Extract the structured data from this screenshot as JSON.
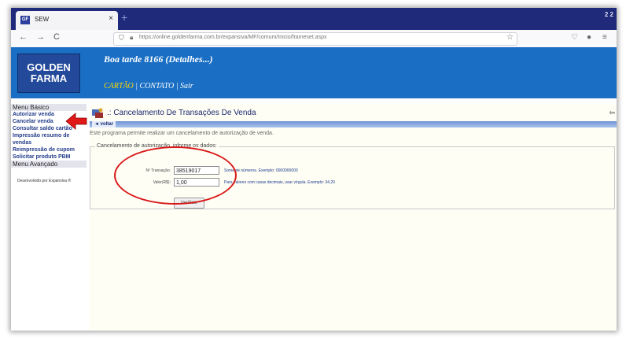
{
  "browser": {
    "tab_title": "SEW",
    "tab_icon_text": "GF",
    "tab_close": "×",
    "new_tab": "+",
    "corner_text": "2 2",
    "back": "←",
    "forward": "→",
    "reload": "C",
    "url": "https://online.goldenfarma.com.br/expansiva/MF/comum/Inicio/frameset.aspx",
    "star": "☆"
  },
  "header": {
    "logo_line1": "GOLDEN",
    "logo_line2": "FARMA",
    "greeting": "Boa tarde 8166 (Detalhes...)",
    "link_cartao": "CARTÃO",
    "link_contato": "CONTATO",
    "link_sair": "Sair",
    "separator": "|"
  },
  "sidebar": {
    "menu_basico": "Menu Básico",
    "items": [
      "Autorizar venda",
      "Cancelar venda",
      "Consultar saldo cartão",
      "Impressão resumo de vendas",
      "Reimpressão de cupom",
      "Solicitar produto PBM"
    ],
    "menu_avancado": "Menu Avançado",
    "footer": "Desenvolvido por Expansiva ®"
  },
  "main": {
    "title": ".: Cancelamento De Transações De Venda",
    "voltar": "◄ voltar",
    "description": "Este programa permite realizar um cancelamento de autorização de venda.",
    "legend": "Cancelamento de autorização, informe os dados:",
    "transacao_label": "Nº Transação:",
    "transacao_value": "38519017",
    "transacao_hint": "Somente números. Exemplo: 0000000000",
    "valor_label": "Valor(R$):",
    "valor_value": "1,00",
    "valor_hint": "Para valores com casas decimais, usar vírgula. Exemplo: 34,20",
    "verify_button": "Verificar"
  },
  "colors": {
    "header_bg": "#1a6fc4",
    "annotation_red": "#d91919"
  }
}
